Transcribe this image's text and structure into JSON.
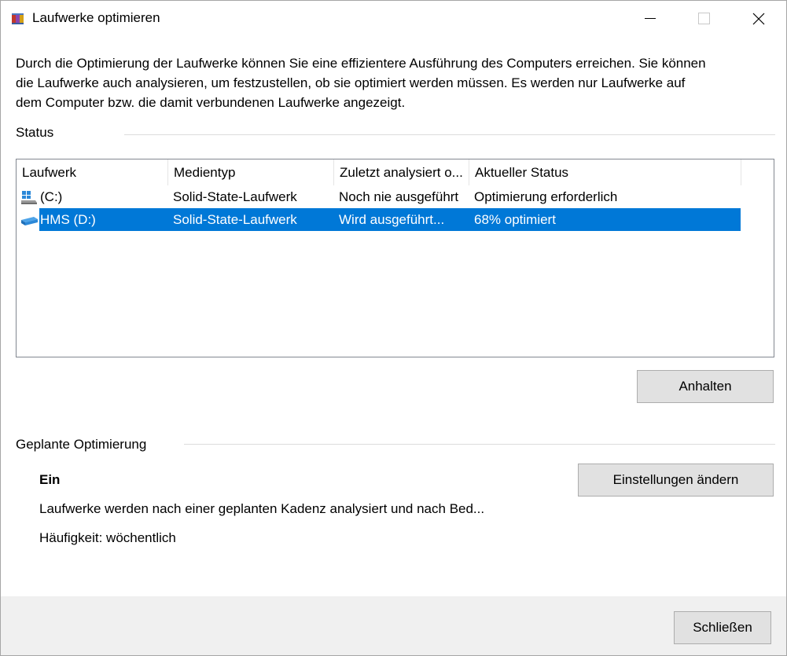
{
  "window": {
    "title": "Laufwerke optimieren",
    "icon": "defrag-app-icon"
  },
  "intro": {
    "text": "Durch die Optimierung der Laufwerke können Sie eine effizientere Ausführung des Computers erreichen. Sie können die Laufwerke auch analysieren, um festzustellen, ob sie optimiert werden müssen. Es werden nur Laufwerke auf dem Computer bzw. die damit verbundenen Laufwerke angezeigt."
  },
  "status": {
    "label": "Status",
    "columns": [
      "Laufwerk",
      "Medientyp",
      "Zuletzt analysiert o...",
      "Aktueller Status"
    ],
    "rows": [
      {
        "drive": "(C:)",
        "media": "Solid-State-Laufwerk",
        "last": "Noch nie ausgeführt",
        "state": "Optimierung erforderlich",
        "icon": "windows-drive-icon",
        "selected": false
      },
      {
        "drive": "HMS (D:)",
        "media": "Solid-State-Laufwerk",
        "last": "Wird ausgeführt...",
        "state": "68% optimiert",
        "icon": "drive-icon",
        "selected": true
      }
    ],
    "action_button": "Anhalten"
  },
  "scheduled": {
    "label": "Geplante Optimierung",
    "state": "Ein",
    "description": "Laufwerke werden nach einer geplanten Kadenz analysiert und nach Bed...",
    "frequency": "Häufigkeit: wöchentlich",
    "settings_button": "Einstellungen ändern"
  },
  "footer": {
    "close_button": "Schließen"
  },
  "colors": {
    "selection": "#0078d7",
    "button_bg": "#e1e1e1",
    "footer_bg": "#f0f0f0"
  }
}
